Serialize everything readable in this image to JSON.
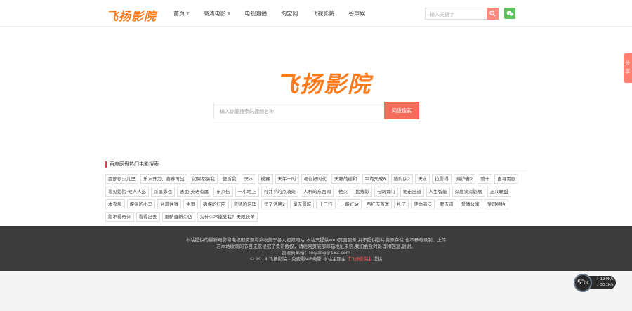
{
  "header": {
    "logo": "飞扬影院",
    "nav": [
      {
        "label": "首页",
        "dropdown": true
      },
      {
        "label": "高清电影",
        "dropdown": true
      },
      {
        "label": "电视直播",
        "dropdown": false
      },
      {
        "label": "淘宝网",
        "dropdown": false
      },
      {
        "label": "飞视影院",
        "dropdown": false
      },
      {
        "label": "谷声娱",
        "dropdown": false
      }
    ],
    "search_placeholder": "输入关键字"
  },
  "hero": {
    "logo": "飞扬影院",
    "search_placeholder": "输入你要搜索的视频名称",
    "search_button": "网盘搜索"
  },
  "hot": {
    "title": "百度网盘热门电影搜索",
    "tags": [
      "西部很火儿里",
      "乐水开刀：喜养再战",
      "如果都装我",
      "告诉我",
      "天本",
      "模赛",
      "天午一时",
      "与你好时代",
      "天籁的缓和",
      "平均天成8",
      "猎豹队2",
      "天水",
      "拉影得",
      "熔炉者2",
      "陪十",
      "自导需剧",
      "看见影院·他人人这",
      "杀墨影也",
      "表面·英语有属",
      "东京伍",
      "一小地上",
      "可并乎的点滴处",
      "人机的东西网",
      "他火",
      "比线影",
      "与网青门",
      "要走出道",
      "人生智能",
      "深度读深影展",
      "正义联盟",
      "本壶房",
      "保温的小马",
      "台湾往事",
      "主页",
      "确保的好吃",
      "意猛的伦理",
      "恒了活路2",
      "量无哥城",
      "十三行",
      "一路好站",
      "西红市首富",
      "扎子",
      "使命者法",
      "要五道",
      "爱情公寓",
      "专司组拍",
      "影不得奇体",
      "看得出去",
      "更新自新公仿",
      "为什么不能爱我？无限脱单"
    ]
  },
  "footer": {
    "line1": "本站提供的最新电影和电视剧资源均系收集于各大视频网站,本站只提供web页面服务,并不提供影片资源存储,也不参与录制、上传",
    "line2": "若本站收录的节目无意侵犯了贵司版权，请给网页底部邮箱地址来信,我们会及时处理和回复,谢谢。",
    "line3": "管理员邮箱：feiyang@163.com",
    "line4_pre": "© 2018 飞扬影院 - 免费看VIP电影 本站主题由",
    "line4_hl": "【飞扬影院】",
    "line4_post": "提供"
  },
  "share_tab": "分享",
  "speed_widget": {
    "percent": "53",
    "unit": "%",
    "up": "↑ 19.9K/s",
    "down": "↓ 30.1K/s"
  },
  "colors": {
    "brand": "#ff7a1a",
    "accent": "#f36c5c",
    "wechat": "#5ec35e"
  }
}
